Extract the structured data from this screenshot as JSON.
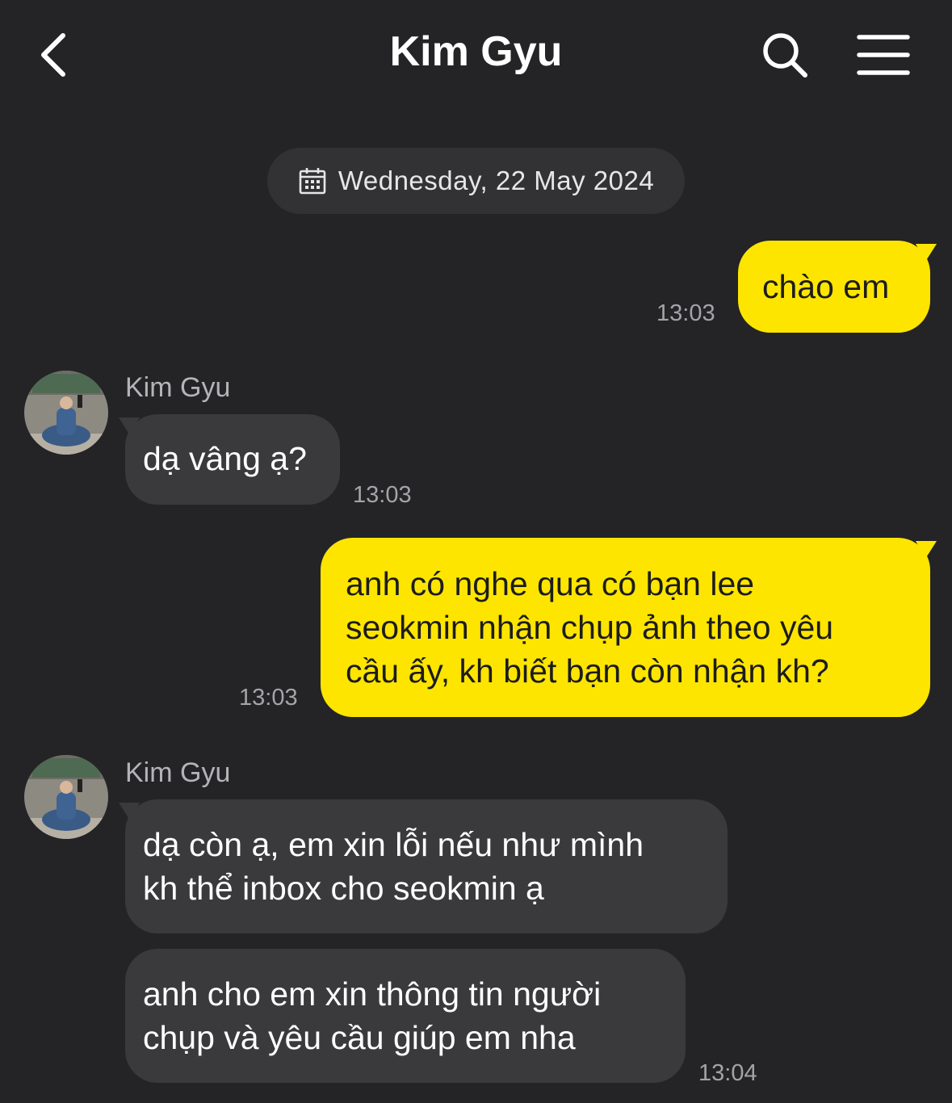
{
  "header": {
    "title": "Kim Gyu",
    "back_icon": "chevron-left-icon",
    "search_icon": "search-icon",
    "menu_icon": "hamburger-menu-icon"
  },
  "date_divider": {
    "icon": "calendar-icon",
    "text": "Wednesday, 22 May 2024"
  },
  "colors": {
    "background": "#242426",
    "outgoing_bubble": "#fee500",
    "incoming_bubble": "#3a3a3c",
    "timestamp": "#a4a4a8"
  },
  "messages": [
    {
      "direction": "out",
      "lines": [
        "chào em"
      ],
      "time": "13:03"
    },
    {
      "direction": "in",
      "sender": "Kim Gyu",
      "lines": [
        "dạ vâng ạ?"
      ],
      "time": "13:03"
    },
    {
      "direction": "out",
      "lines": [
        "anh có nghe qua có bạn lee",
        "seokmin nhận chụp ảnh theo yêu",
        "cầu ấy, kh biết bạn còn nhận kh?"
      ],
      "time": "13:03"
    },
    {
      "direction": "in",
      "sender": "Kim Gyu",
      "lines": [
        "dạ còn ạ, em xin lỗi nếu như mình",
        "kh thể inbox cho seokmin ạ"
      ]
    },
    {
      "direction": "in",
      "lines": [
        "anh cho em xin thông tin người",
        "chụp và yêu cầu giúp em nha"
      ],
      "time": "13:04"
    }
  ]
}
